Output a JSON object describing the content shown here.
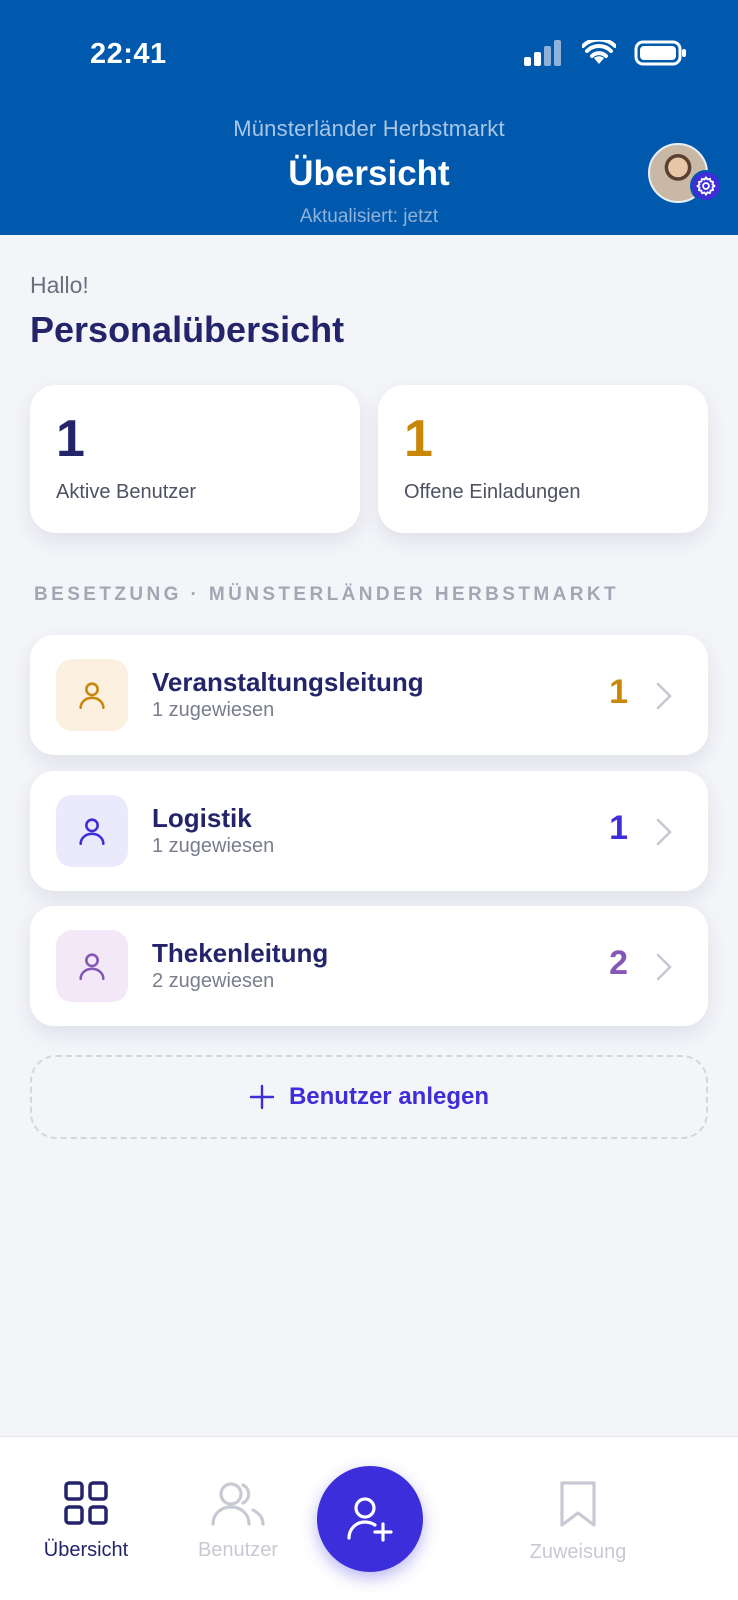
{
  "status_bar": {
    "time": "22:41"
  },
  "header": {
    "subtitle": "Münsterländer Herbstmarkt",
    "title": "Übersicht",
    "updated": "Aktualisiert: jetzt"
  },
  "greeting": "Hallo!",
  "page_title": "Personalübersicht",
  "stats": [
    {
      "value": "1",
      "label": "Aktive Benutzer",
      "color": "#23246a"
    },
    {
      "value": "1",
      "label": "Offene Einladungen",
      "color": "#c9870a"
    }
  ],
  "section_label": "BESETZUNG · MÜNSTERLÄNDER HERBSTMARKT",
  "roles": [
    {
      "name": "Veranstaltungsleitung",
      "assigned": "1 zugewiesen",
      "count": "1",
      "color": "#c9870a",
      "bg": "#fbf0df"
    },
    {
      "name": "Logistik",
      "assigned": "1 zugewiesen",
      "count": "1",
      "color": "#3d2ed8",
      "bg": "#ebeafc"
    },
    {
      "name": "Thekenleitung",
      "assigned": "2 zugewiesen",
      "count": "2",
      "color": "#8458b5",
      "bg": "#f3e8f8"
    }
  ],
  "add_user_label": "Benutzer anlegen",
  "tabs": [
    {
      "label": "Übersicht",
      "icon": "grid-icon",
      "active": true
    },
    {
      "label": "Benutzer",
      "icon": "users-icon",
      "active": false
    },
    {
      "label": "Zuweisung",
      "icon": "bookmark-icon",
      "active": false
    }
  ],
  "fab_icon": "add-user-icon",
  "colors": {
    "primary": "#0059ac",
    "accent": "#3d2ed8",
    "navy": "#23246a"
  }
}
